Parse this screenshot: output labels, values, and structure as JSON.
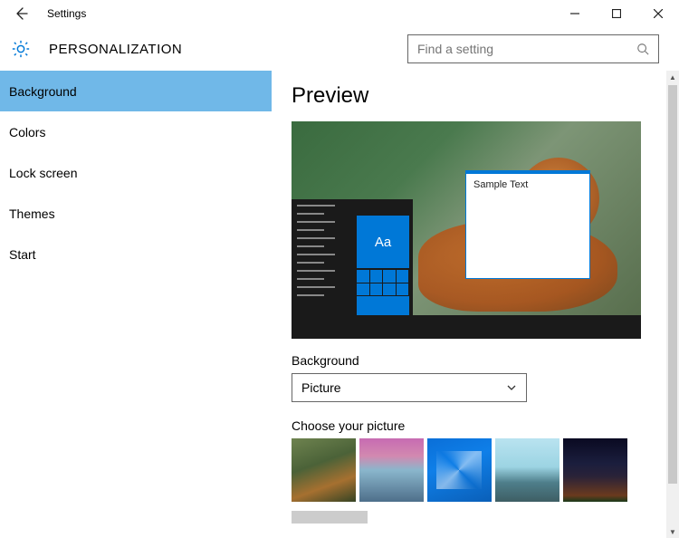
{
  "window": {
    "title": "Settings",
    "back_icon": "←",
    "min_icon": "—",
    "max_icon": "☐",
    "close_icon": "✕"
  },
  "header": {
    "category": "PERSONALIZATION"
  },
  "search": {
    "placeholder": "Find a setting"
  },
  "sidebar": {
    "items": [
      {
        "label": "Background",
        "active": true
      },
      {
        "label": "Colors",
        "active": false
      },
      {
        "label": "Lock screen",
        "active": false
      },
      {
        "label": "Themes",
        "active": false
      },
      {
        "label": "Start",
        "active": false
      }
    ]
  },
  "content": {
    "preview_heading": "Preview",
    "sample_text": "Sample Text",
    "start_tile_text": "Aa",
    "background_label": "Background",
    "background_value": "Picture",
    "choose_label": "Choose your picture",
    "thumbs": [
      {
        "name": "thumb-tiger"
      },
      {
        "name": "thumb-venice-sunset"
      },
      {
        "name": "thumb-windows-hero"
      },
      {
        "name": "thumb-beach-rock"
      },
      {
        "name": "thumb-night-sky"
      }
    ]
  }
}
